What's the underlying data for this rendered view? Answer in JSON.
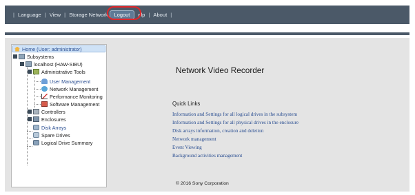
{
  "topbar": {
    "items": [
      "Language",
      "View",
      "Storage Network",
      "Logout",
      "elp",
      "About"
    ]
  },
  "tree": {
    "home": "Home (User: administrator)",
    "subsystems": "Subsystems",
    "localhost": "localhost (HAW-SIBU)",
    "admin_tools": "Administrative Tools",
    "user_management": "User Management",
    "network_management": "Network Management",
    "performance_monitoring": "Performance Monitoring",
    "software_management": "Software Management",
    "controllers": "Controllers",
    "enclosures": "Enclosures",
    "disk_arrays": "Disk Arrays",
    "spare_drives": "Spare Drives",
    "logical_drive_summary": "Logical Drive Summary"
  },
  "main": {
    "title": "Network Video Recorder",
    "quick_links_title": "Quick Links",
    "quick_links": [
      "Information and Settings for all logical drives in the subsystem",
      "Information and Settings for all physical drives in the enclosure",
      "Disk arrays information, creation and deletion",
      "Network management",
      "Event Viewing",
      "Background activities management"
    ],
    "footer": "© 2016 Sony Corporation"
  },
  "colors": {
    "topbar": "#4b5968",
    "highlight_circle": "#e0262a",
    "link": "#2b4f92",
    "panel": "#e4e4e4"
  }
}
